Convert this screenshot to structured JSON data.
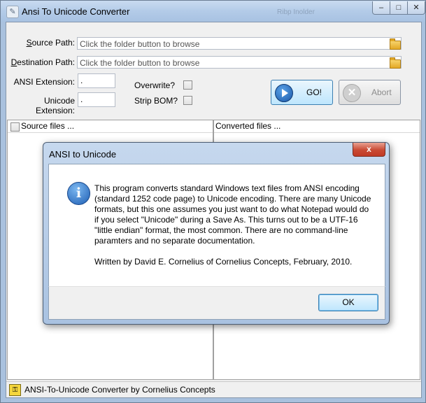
{
  "window": {
    "title": "Ansi To Unicode Converter",
    "ghost_title": "Ribp Inolder"
  },
  "window_controls": {
    "minimize": "–",
    "maximize": "□",
    "close": "✕"
  },
  "form": {
    "source_label_pre": "S",
    "source_label_post": "ource Path:",
    "source_placeholder": "Click the folder button to browse",
    "dest_label_pre": "D",
    "dest_label_post": "estination Path:",
    "dest_placeholder": "Click the folder button to browse",
    "ansi_ext_label": "ANSI Extension:",
    "ansi_ext_value": ".",
    "unicode_ext_label": "Unicode Extension:",
    "unicode_ext_value": ".",
    "overwrite_label": "Overwrite?",
    "strip_bom_label": "Strip BOM?"
  },
  "buttons": {
    "go": "GO!",
    "abort": "Abort"
  },
  "panes": {
    "source_header": "Source files ...",
    "converted_header": "Converted files ..."
  },
  "status": {
    "text": "ANSI-To-Unicode Converter by Cornelius Concepts"
  },
  "dialog": {
    "title": "ANSI to Unicode",
    "close": "x",
    "icon_glyph": "i",
    "message": "This program converts standard Windows text files from ANSI encoding (standard 1252 code page) to Unicode encoding. There are many Unicode formats, but this one assumes you just want to do what Notepad would do if you select \"Unicode\" during a Save As.  This turns out to be a UTF-16 \"little endian\" format, the most common. There are no command-line paramters and no separate documentation.",
    "credit": "Written by David E. Cornelius of Cornelius Concepts, February, 2010.",
    "ok": "OK"
  }
}
